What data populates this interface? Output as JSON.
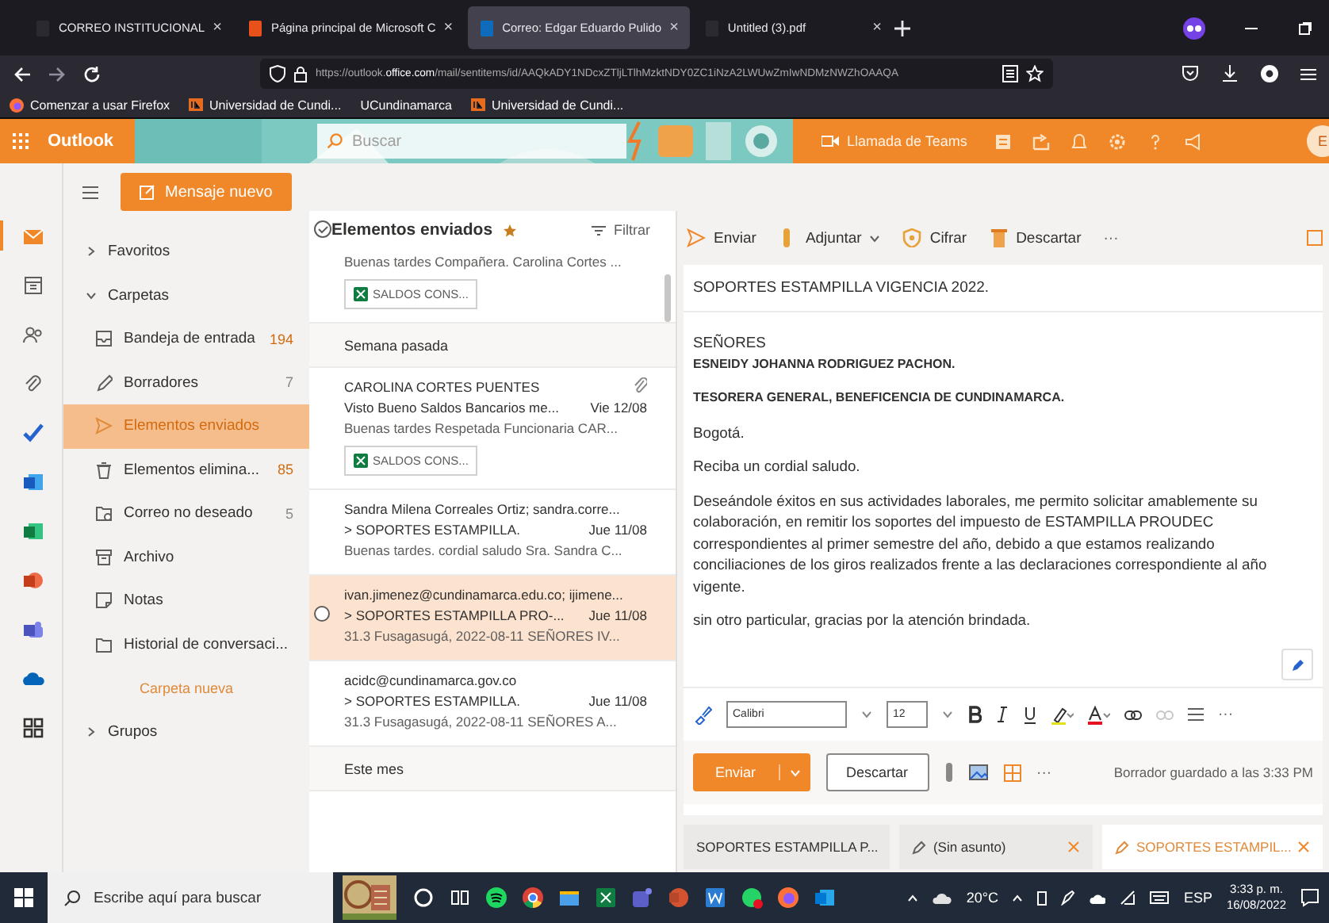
{
  "browser": {
    "tabs": [
      {
        "label": "CORREO INSTITUCIONAL",
        "close": "×",
        "selected": false
      },
      {
        "label": "Página principal de Microsoft C",
        "close": "×",
        "selected": false
      },
      {
        "label": "Correo: Edgar Eduardo Pulido",
        "close": "×",
        "selected": true
      },
      {
        "label": "Untitled (3).pdf",
        "close": "×",
        "selected": false
      }
    ],
    "url": "https://outlook.**office.com**/mail/sentitems/id/AAQkADY1NDcxZTljLTlhMzktNDY0ZC1iNzA2LWUwZmIwNDMzNWZhOAAQA",
    "bookmarks": [
      "Comenzar a usar Firefox",
      "Universidad de Cundi...",
      "UCundinamarca",
      "Universidad de Cundi..."
    ]
  },
  "app": {
    "name": "Outlook",
    "search_placeholder": "Buscar",
    "teams_button": "Llamada de Teams",
    "avatar": "E"
  },
  "rail": [
    {
      "selected": true
    },
    {
      "selected": false
    },
    {
      "selected": false
    },
    {
      "selected": false
    },
    {
      "selected": false
    },
    {
      "selected": false
    },
    {
      "selected": false
    },
    {
      "selected": false
    },
    {
      "selected": false
    },
    {
      "selected": false
    },
    {
      "selected": false
    }
  ],
  "folders": {
    "new_message": "Mensaje nuevo",
    "tree": [
      {
        "label": "Favoritos",
        "expanded": false
      },
      {
        "label": "Carpetas",
        "expanded": true,
        "new_folder": "Carpeta nueva",
        "children": [
          {
            "label": "Bandeja de entrada",
            "count": "194",
            "count_highlight": true,
            "selected": false
          },
          {
            "label": "Borradores",
            "count": "7",
            "count_highlight": false,
            "selected": false
          },
          {
            "label": "Elementos enviados",
            "selected": true
          },
          {
            "label": "Elementos elimina...",
            "count": "85",
            "count_highlight": true,
            "selected": false
          },
          {
            "label": "Correo no deseado",
            "count": "5",
            "count_highlight": false,
            "selected": false
          },
          {
            "label": "Archivo",
            "selected": false
          },
          {
            "label": "Notas",
            "selected": false
          },
          {
            "label": "Historial de conversaci...",
            "selected": false
          }
        ]
      },
      {
        "label": "Grupos",
        "expanded": false
      }
    ]
  },
  "mail_list": {
    "title": "Elementos enviados",
    "favorite": true,
    "filter": "Filtrar",
    "items": [
      {
        "kind": "message",
        "preview": "Buenas tardes Compañera. Carolina Cortes ...",
        "attachment": "SALDOS CONS...",
        "selected": false
      },
      {
        "kind": "group",
        "label": "Semana pasada"
      },
      {
        "kind": "message",
        "sender": "CAROLINA CORTES PUENTES",
        "subject": "Visto Bueno Saldos Bancarios me...",
        "date": "Vie 12/08",
        "preview": "Buenas tardes Respetada Funcionaria CAR...",
        "attachment": "SALDOS CONS...",
        "has_attachment": true,
        "selected": false
      },
      {
        "kind": "message",
        "sender": "Sandra Milena Correales Ortiz; sandra.corre...",
        "subject": "> SOPORTES ESTAMPILLA.",
        "date": "Jue 11/08",
        "preview": "Buenas tardes. cordial saludo Sra. Sandra C...",
        "selected": false
      },
      {
        "kind": "message",
        "sender": "ivan.jimenez@cundinamarca.edu.co; ijimene...",
        "subject": "> SOPORTES ESTAMPILLA PRO-...",
        "date": "Jue 11/08",
        "preview": "31.3 Fusagasugá, 2022-08-11 SEÑORES IV...",
        "selected": true
      },
      {
        "kind": "message",
        "sender": "acidc@cundinamarca.gov.co",
        "subject": "> SOPORTES ESTAMPILLA.",
        "date": "Jue 11/08",
        "preview": "31.3 Fusagasugá, 2022-08-11 SEÑORES A...",
        "selected": false
      },
      {
        "kind": "group",
        "label": "Este mes"
      }
    ]
  },
  "compose": {
    "toolbar": [
      {
        "kind": "send",
        "label": "Enviar"
      },
      {
        "kind": "attach",
        "label": "Adjuntar"
      },
      {
        "kind": "encrypt",
        "label": "Cifrar"
      },
      {
        "kind": "discard",
        "label": "Descartar"
      },
      {
        "kind": "more",
        "label": "···"
      }
    ],
    "subject": "SOPORTES ESTAMPILLA VIGENCIA 2022.",
    "body": [
      {
        "text": "SEÑORES",
        "bold": false
      },
      {
        "text": "ESNEIDY JOHANNA RODRIGUEZ PACHON.",
        "bold": true
      },
      {
        "text": "TESORERA GENERAL, BENEFICENCIA DE CUNDINAMARCA.",
        "bold": true
      },
      {
        "text": "Bogotá.",
        "bold": false
      },
      {
        "text": "Reciba un cordial saludo.",
        "bold": false
      },
      {
        "text": "Deseándole éxitos en sus actividades laborales, me permito solicitar amablemente su colaboración, en remitir los soportes del impuesto de ESTAMPILLA PROUDEC correspondientes al primer semestre del año, debido a que estamos realizando conciliaciones de los giros realizados frente a las declaraciones correspondiente al año vigente.",
        "bold": false
      },
      {
        "text": "sin otro particular, gracias por la atención brindada.",
        "bold": false
      }
    ],
    "font": "Calibri",
    "size": "12",
    "more": "···",
    "send": "Enviar",
    "discard": "Descartar",
    "actions_more": "···",
    "status": "Borrador guardado a las 3:33 PM",
    "drafts": [
      {
        "label": "SOPORTES ESTAMPILLA P...",
        "draft": false,
        "closable": false,
        "selected": false
      },
      {
        "label": "(Sin asunto)",
        "draft": true,
        "closable": true,
        "selected": false
      },
      {
        "label": "SOPORTES ESTAMPIL...",
        "draft": true,
        "closable": true,
        "selected": true
      }
    ]
  },
  "taskbar": {
    "search_placeholder": "Escribe aquí para buscar",
    "weather": "20°C",
    "language": "ESP",
    "time": "3:33 p. m.",
    "date": "16/08/2022"
  }
}
